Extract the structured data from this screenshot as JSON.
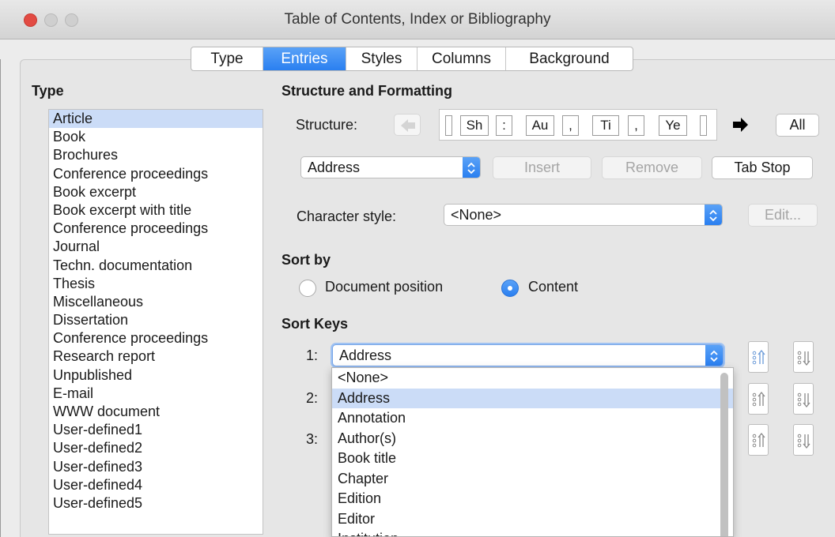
{
  "window": {
    "title": "Table of Contents, Index or Bibliography"
  },
  "tabs": [
    {
      "label": "Type",
      "active": false
    },
    {
      "label": "Entries",
      "active": true
    },
    {
      "label": "Styles",
      "active": false
    },
    {
      "label": "Columns",
      "active": false
    },
    {
      "label": "Background",
      "active": false
    }
  ],
  "type_panel": {
    "heading": "Type",
    "items": [
      "Article",
      "Book",
      "Brochures",
      "Conference proceedings",
      "Book excerpt",
      "Book excerpt with title",
      "Conference proceedings",
      "Journal",
      "Techn. documentation",
      "Thesis",
      "Miscellaneous",
      "Dissertation",
      "Conference proceedings",
      "Research report",
      "Unpublished",
      "E-mail",
      "WWW document",
      "User-defined1",
      "User-defined2",
      "User-defined3",
      "User-defined4",
      "User-defined5"
    ],
    "selected": "Article"
  },
  "structure": {
    "heading": "Structure and Formatting",
    "label": "Structure:",
    "tokens": [
      "Sh",
      ":",
      "Au",
      ",",
      "Ti",
      ",",
      "Ye"
    ],
    "all_button": "All"
  },
  "entry_row": {
    "field_select": "Address",
    "insert_button": "Insert",
    "remove_button": "Remove",
    "tab_stop_button": "Tab Stop"
  },
  "character_style": {
    "label": "Character style:",
    "value": "<None>",
    "edit_button": "Edit..."
  },
  "sort_by": {
    "heading": "Sort by",
    "options": [
      "Document position",
      "Content"
    ],
    "selected": "Content"
  },
  "sort_keys": {
    "heading": "Sort Keys",
    "labels": [
      "1:",
      "2:",
      "3:"
    ],
    "key1_value": "Address"
  },
  "dropdown": {
    "items": [
      "<None>",
      "Address",
      "Annotation",
      "Author(s)",
      "Book title",
      "Chapter",
      "Edition",
      "Editor",
      "Institution"
    ],
    "highlighted": "Address"
  },
  "colors": {
    "accent": "#2a7ff0",
    "selection": "#cbdcf7",
    "close": "#e24b43"
  }
}
